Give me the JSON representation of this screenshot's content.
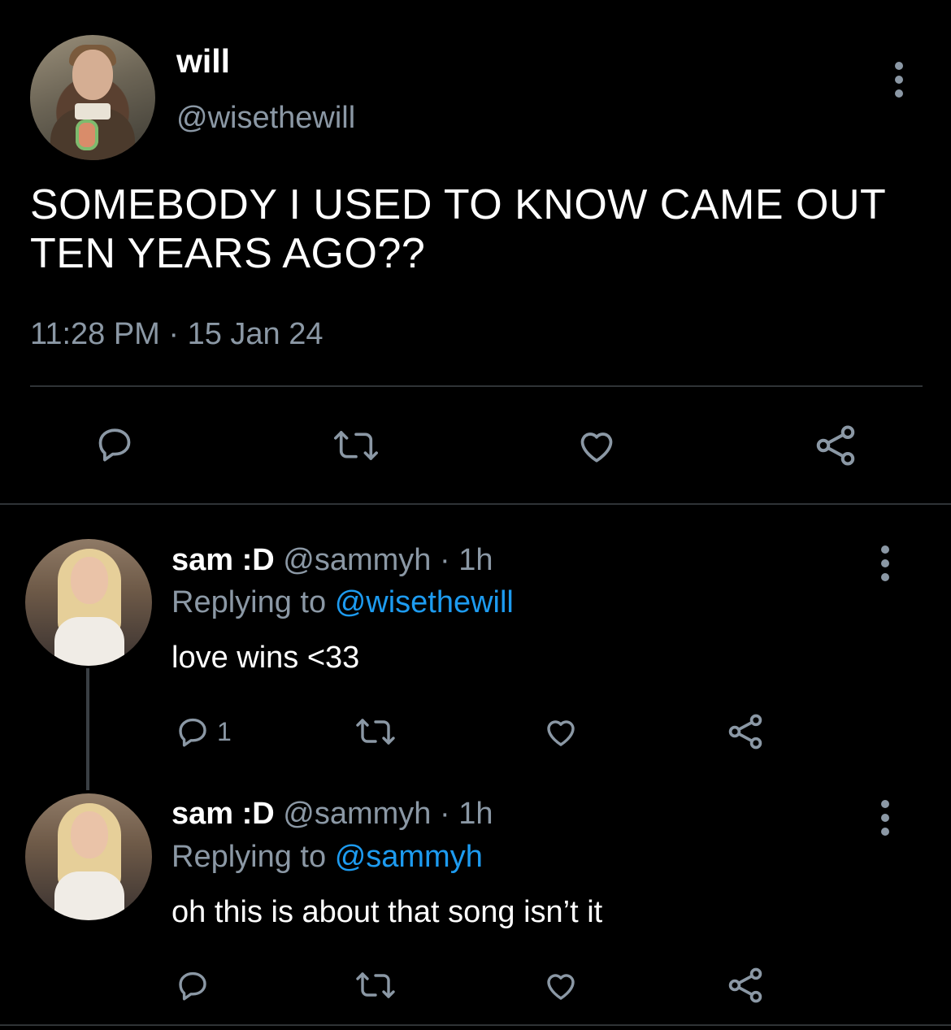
{
  "main_tweet": {
    "name": "will",
    "handle": "@wisethewill",
    "text": "SOMEBODY I USED TO KNOW CAME OUT TEN YEARS AGO??",
    "timestamp": "11:28 PM · 15 Jan 24",
    "actions": [
      "reply-icon",
      "retweet-icon",
      "like-icon",
      "share-icon"
    ]
  },
  "replies": [
    {
      "name": "sam :D",
      "handle": "@sammyh",
      "time": "· 1h",
      "replying_prefix": "Replying to",
      "replying_to": "@wisethewill",
      "text": "love wins <33",
      "reply_count": "1"
    },
    {
      "name": "sam :D",
      "handle": "@sammyh",
      "time": "· 1h",
      "replying_prefix": "Replying to",
      "replying_to": "@sammyh",
      "text": "oh this is about that song isn’t it",
      "reply_count": ""
    }
  ],
  "colors": {
    "background": "#000000",
    "primary_text": "#ffffff",
    "secondary_text": "#8b98a5",
    "link": "#1d9bf0",
    "divider": "#2f3336"
  }
}
